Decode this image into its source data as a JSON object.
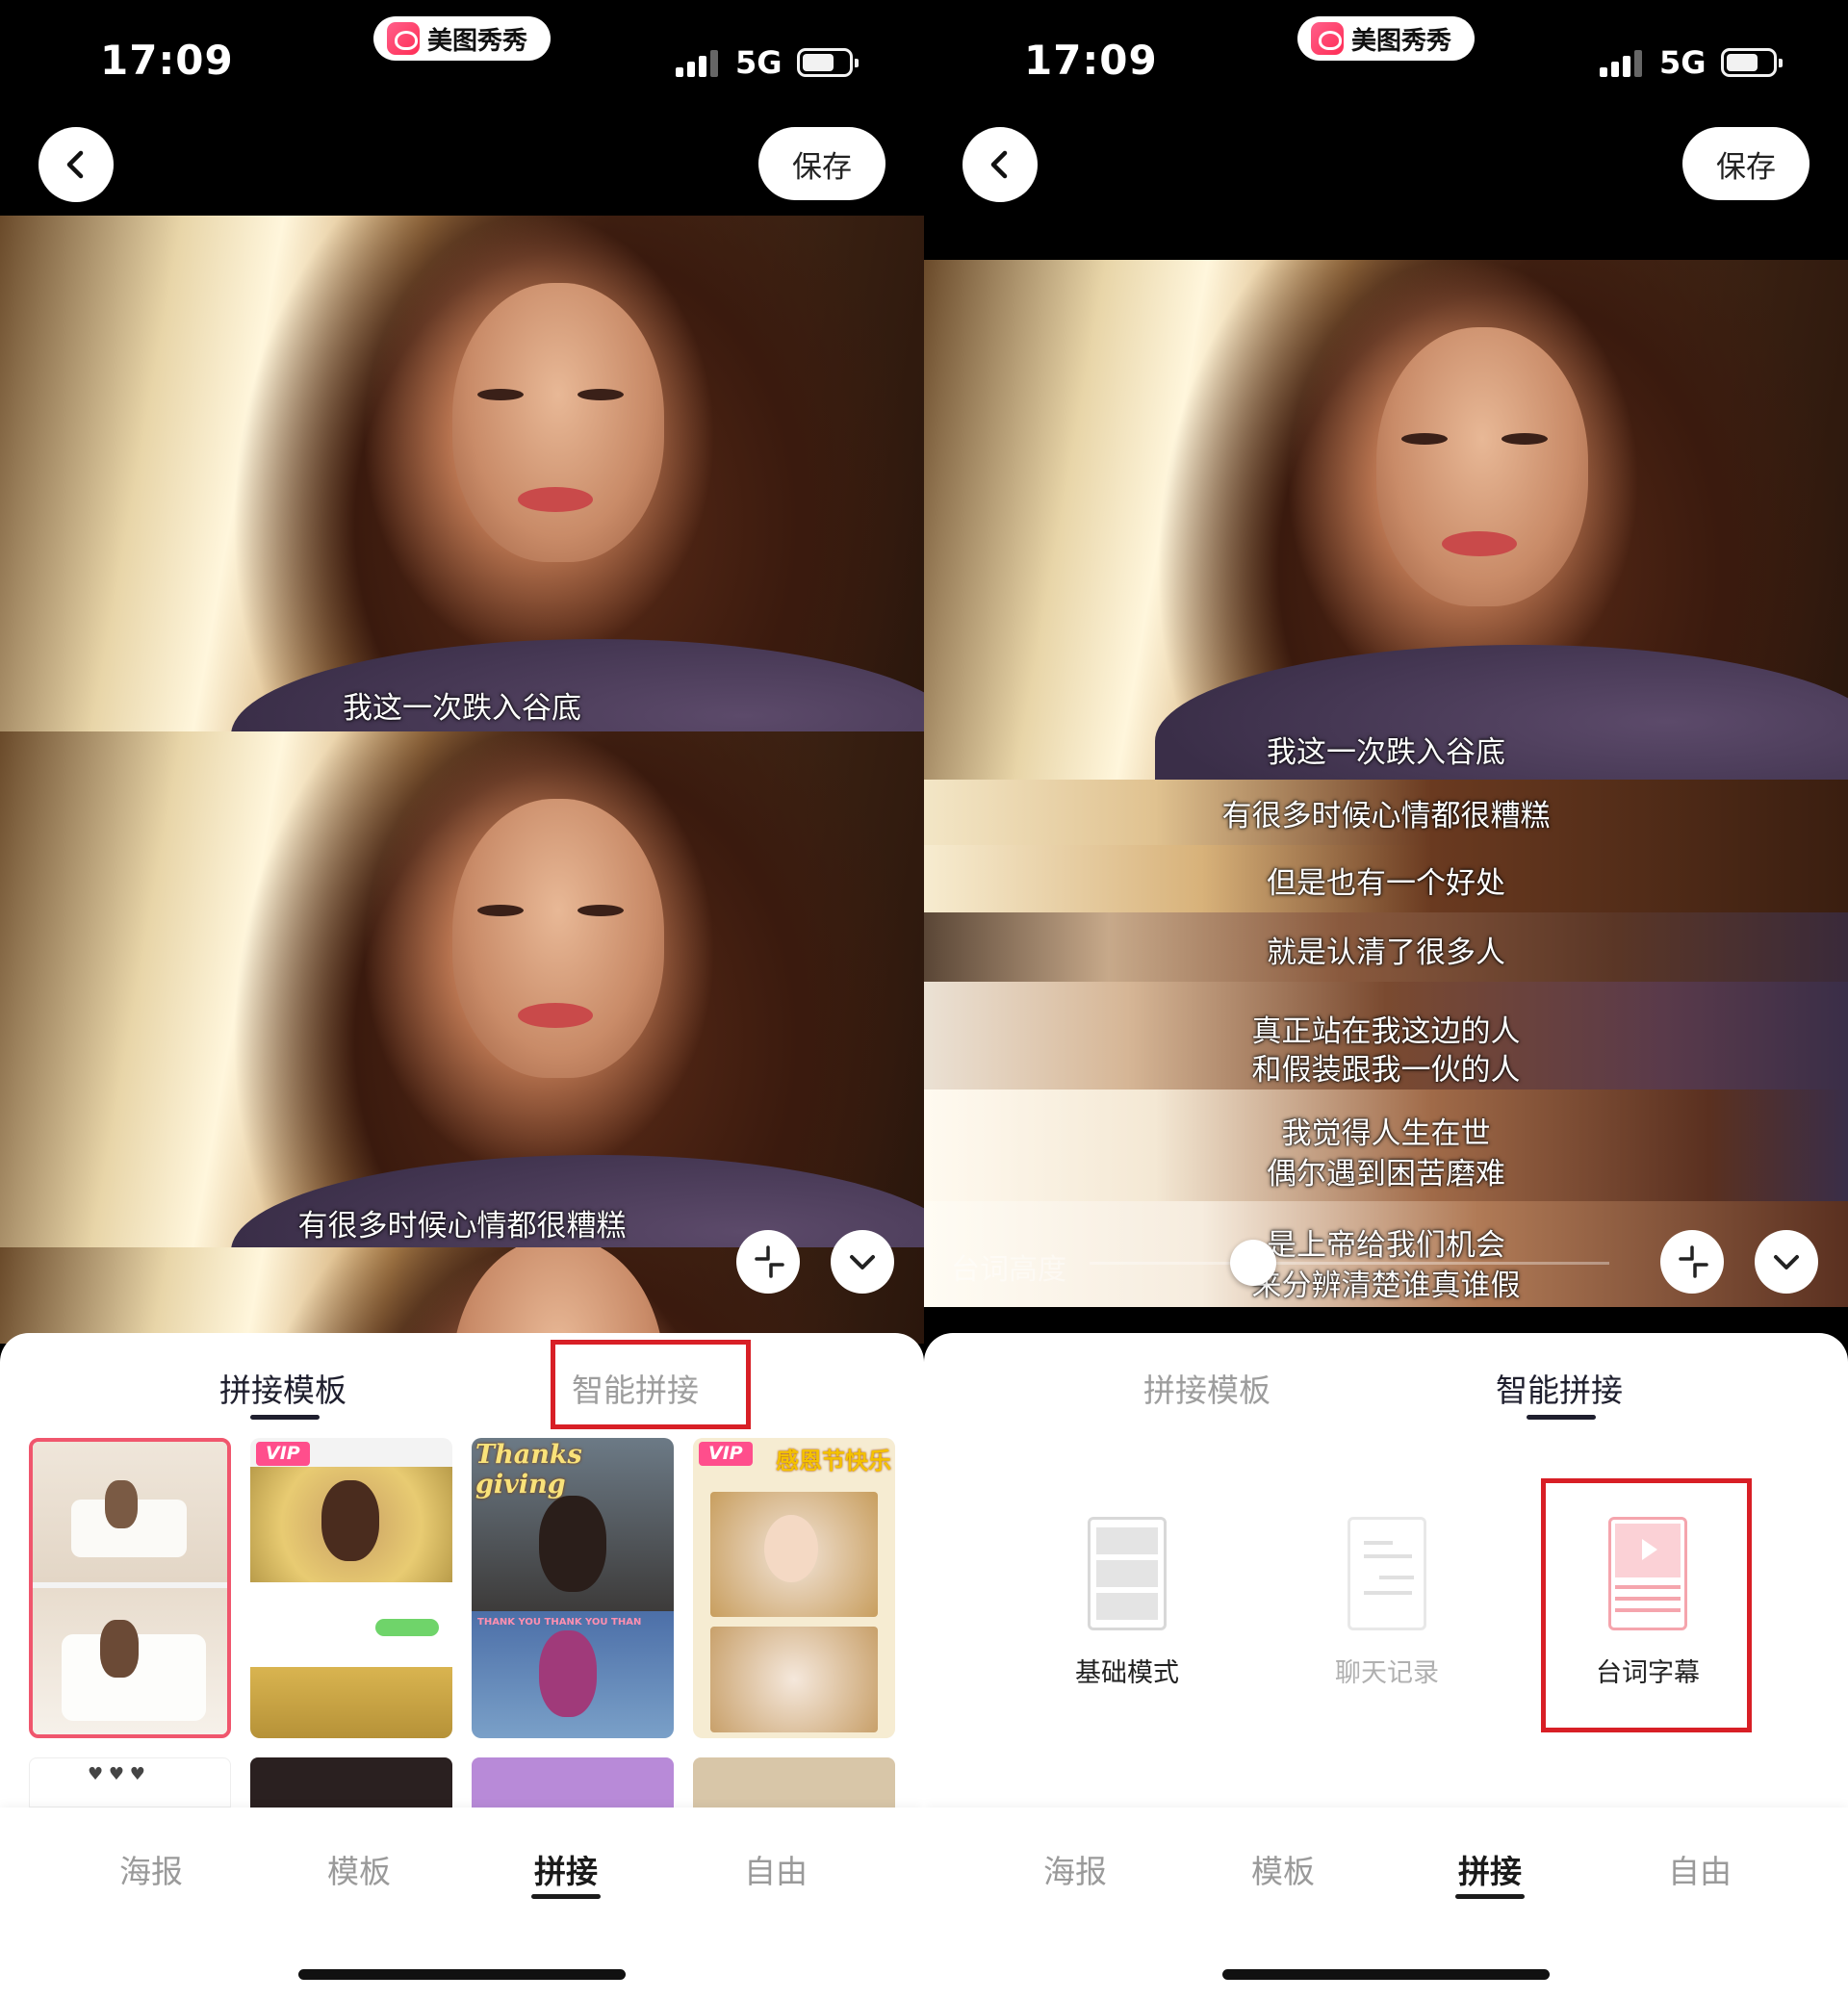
{
  "status": {
    "time": "17:09",
    "app_name": "美图秀秀",
    "network": "5G"
  },
  "nav": {
    "save_label": "保存"
  },
  "left": {
    "subtitles": [
      "我这一次跌入谷底",
      "有很多时候心情都很糟糕"
    ],
    "tabs": [
      "拼接模板",
      "智能拼接"
    ],
    "active_tab": "拼接模板",
    "thumbs": [
      {
        "name": "template-1",
        "vip": ""
      },
      {
        "name": "template-2",
        "vip": "VIP"
      },
      {
        "name": "template-3",
        "title": "Thanks giving",
        "caption": "THANK YOU  THANK YOU  THAN"
      },
      {
        "name": "template-4",
        "vip": "VIP",
        "title": "感恩节快乐"
      }
    ]
  },
  "right": {
    "subtitles": [
      "我这一次跌入谷底",
      "有很多时候心情都很糟糕",
      "但是也有一个好处",
      "就是认清了很多人",
      "真正站在我这边的人",
      "和假装跟我一伙的人",
      "我觉得人生在世",
      "偶尔遇到困苦磨难",
      "是上帝给我们机会",
      "来分辨清楚谁真谁假"
    ],
    "slider_label": "台词高度",
    "tabs": [
      "拼接模板",
      "智能拼接"
    ],
    "active_tab": "智能拼接",
    "modes": [
      "基础模式",
      "聊天记录",
      "台词字幕"
    ]
  },
  "bottom_nav": [
    "海报",
    "模板",
    "拼接",
    "自由"
  ],
  "bottom_nav_active": "拼接",
  "colors": {
    "highlight_red": "#d81f26",
    "vip_pink": "#ff4e8c",
    "selected_border": "#f0566d",
    "mode_pink": "#f5a5ad"
  }
}
